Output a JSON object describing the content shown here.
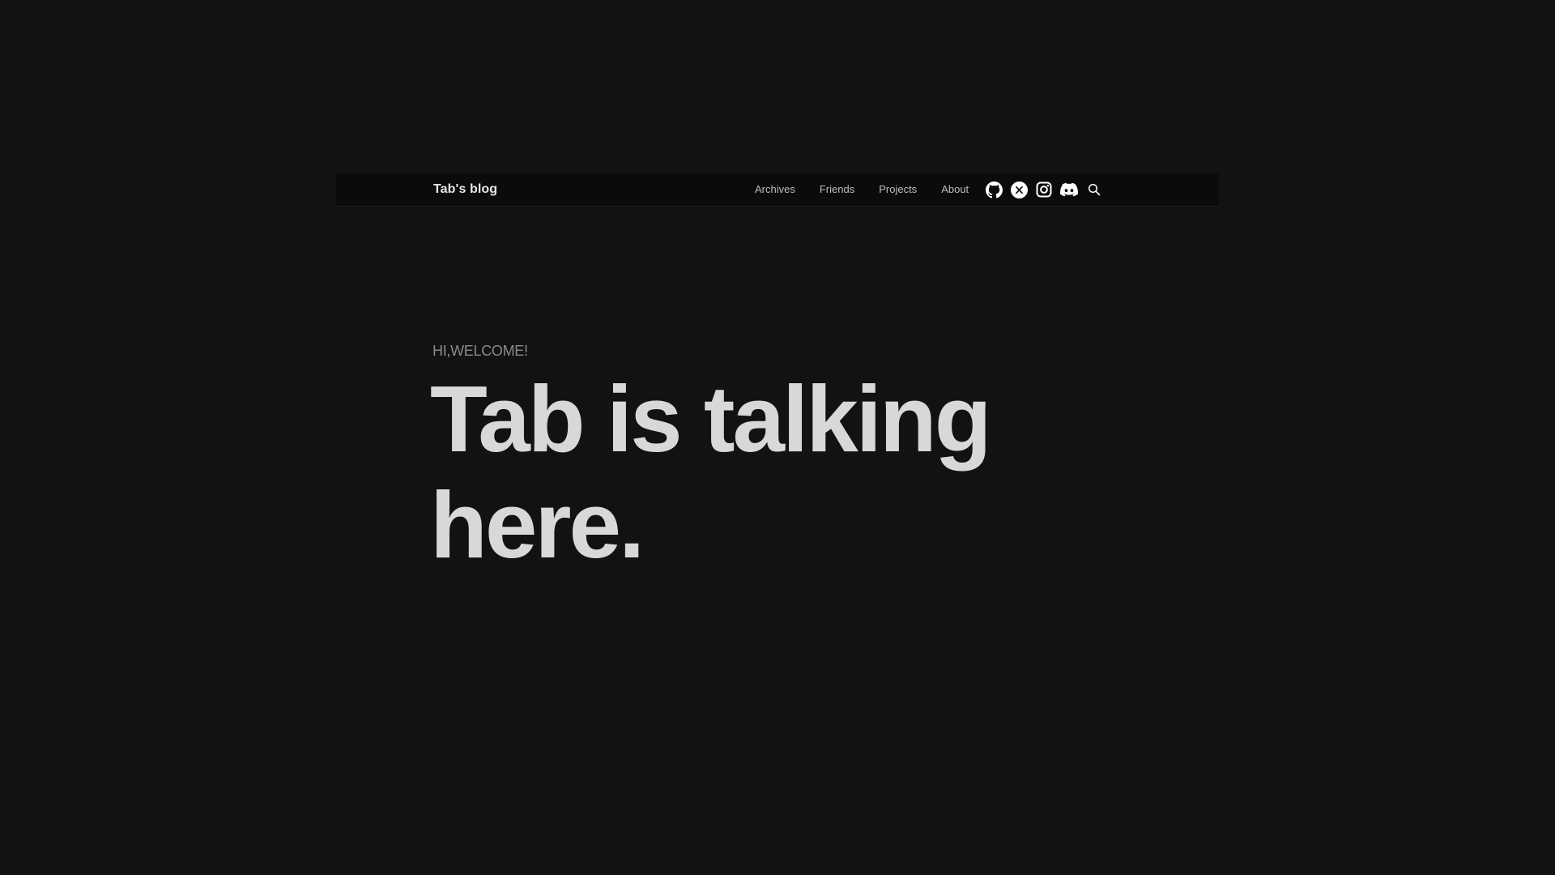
{
  "header": {
    "brand": "Tab's blog",
    "nav": [
      {
        "label": "Archives"
      },
      {
        "label": "Friends"
      },
      {
        "label": "Projects"
      },
      {
        "label": "About"
      }
    ],
    "icons": [
      "github-icon",
      "x-icon",
      "instagram-icon",
      "discord-icon",
      "search-icon"
    ]
  },
  "hero": {
    "kicker": "HI,WELCOME!",
    "title_line1": "Tab is talking",
    "title_line2": "here."
  },
  "colors": {
    "background": "#121212",
    "navbar_bg": "#0b0b0b",
    "text_primary": "#d8d8d8",
    "text_nav": "#bdbdbd",
    "text_muted": "#8a8a8a"
  }
}
